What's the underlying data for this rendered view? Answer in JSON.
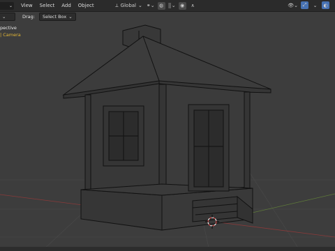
{
  "header": {
    "menus": [
      "View",
      "Select",
      "Add",
      "Object"
    ],
    "transform_orientation": "Global"
  },
  "tool_settings": {
    "drag_label": "Drag:",
    "drag_value": "Select Box"
  },
  "viewport": {
    "view_name": "pective",
    "collection_info": "| Camera"
  },
  "colors": {
    "accent": "#4772b3",
    "overlay_yellow": "#e2b636"
  },
  "icons": [
    "chevron-down-icon",
    "link-icon",
    "magnet-icon",
    "grid-snap-icon",
    "proportional-edit-icon",
    "falloff-curve-icon",
    "visibility-icon",
    "gizmo-icon",
    "overlay-icon",
    "xray-icon",
    "cursor-icon"
  ]
}
